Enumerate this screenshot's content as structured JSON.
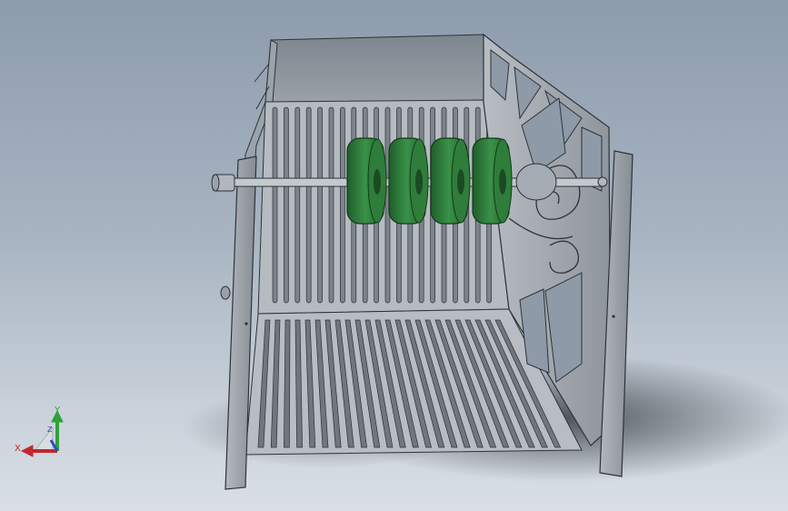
{
  "viewport": {
    "background_top": "#8d9cad",
    "background_bottom": "#d9dfe5"
  },
  "model": {
    "frame_color": "#a9afb6",
    "frame_edge_color": "#2e3338",
    "roller_color": "#2f7d3a",
    "roller_edge_color": "#143a1b",
    "roller_count": 4
  },
  "triad": {
    "x_label": "X",
    "y_label": "Y",
    "z_label": "Z",
    "x_color": "#c0282a",
    "y_color": "#2fa13a",
    "z_color": "#2a4dc0"
  }
}
